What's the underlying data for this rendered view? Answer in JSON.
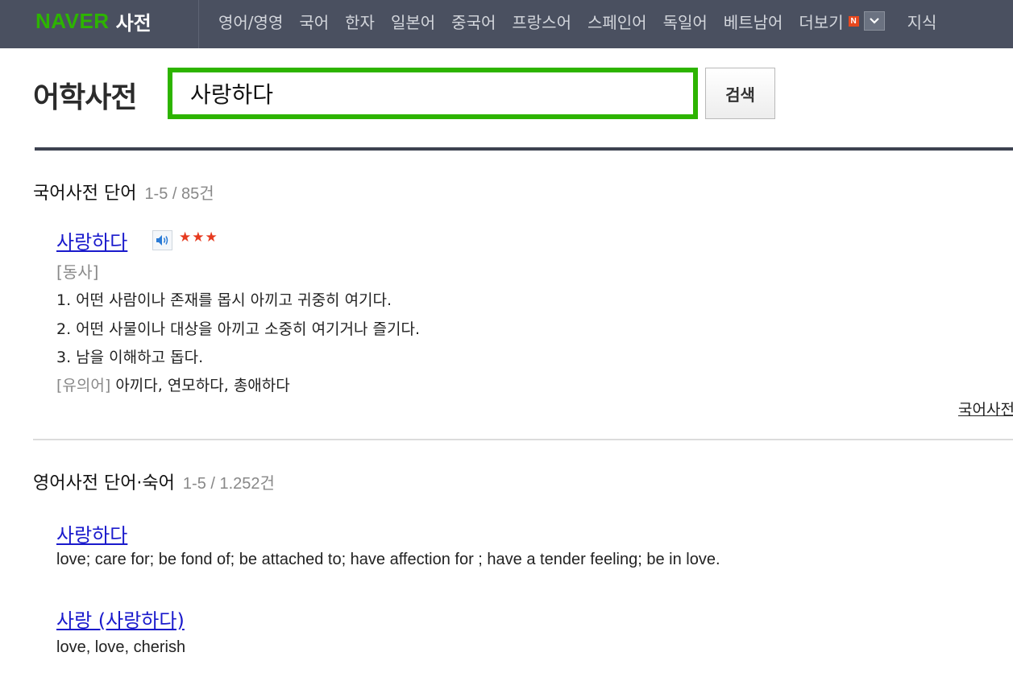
{
  "header": {
    "logo_naver": "NAVER",
    "logo_sajeon": "사전",
    "nav": [
      "영어/영영",
      "국어",
      "한자",
      "일본어",
      "중국어",
      "프랑스어",
      "스페인어",
      "독일어",
      "베트남어"
    ],
    "more_label": "더보기",
    "new_badge": "N",
    "extra_label": "지식"
  },
  "search": {
    "page_title": "어학사전",
    "query": "사랑하다",
    "button_label": "검색"
  },
  "korean_section": {
    "heading": "국어사전 단어",
    "count": "1-5 / 85건",
    "entry_word": "사랑하다",
    "stars": "★★★",
    "pos": "[동사]",
    "definitions": [
      "1. 어떤 사람이나 존재를 몹시 아끼고 귀중히 여기다.",
      "2. 어떤 사물이나 대상을 아끼고 소중히 여기거나 즐기다.",
      "3. 남을 이해하고 돕다."
    ],
    "synonym_label": "[유의어]",
    "synonyms": "아끼다, 연모하다, 총애하다",
    "more_link": "국어사전"
  },
  "english_section": {
    "heading": "영어사전 단어·숙어",
    "count": "1-5 / 1.252건",
    "entries": [
      {
        "word": "사랑하다",
        "meaning": "love; care for; be fond of; be attached to; have affection for ; have a tender feeling; be in love."
      },
      {
        "word": "사랑 (사랑하다)",
        "meaning": "love, love, cherish"
      }
    ]
  }
}
